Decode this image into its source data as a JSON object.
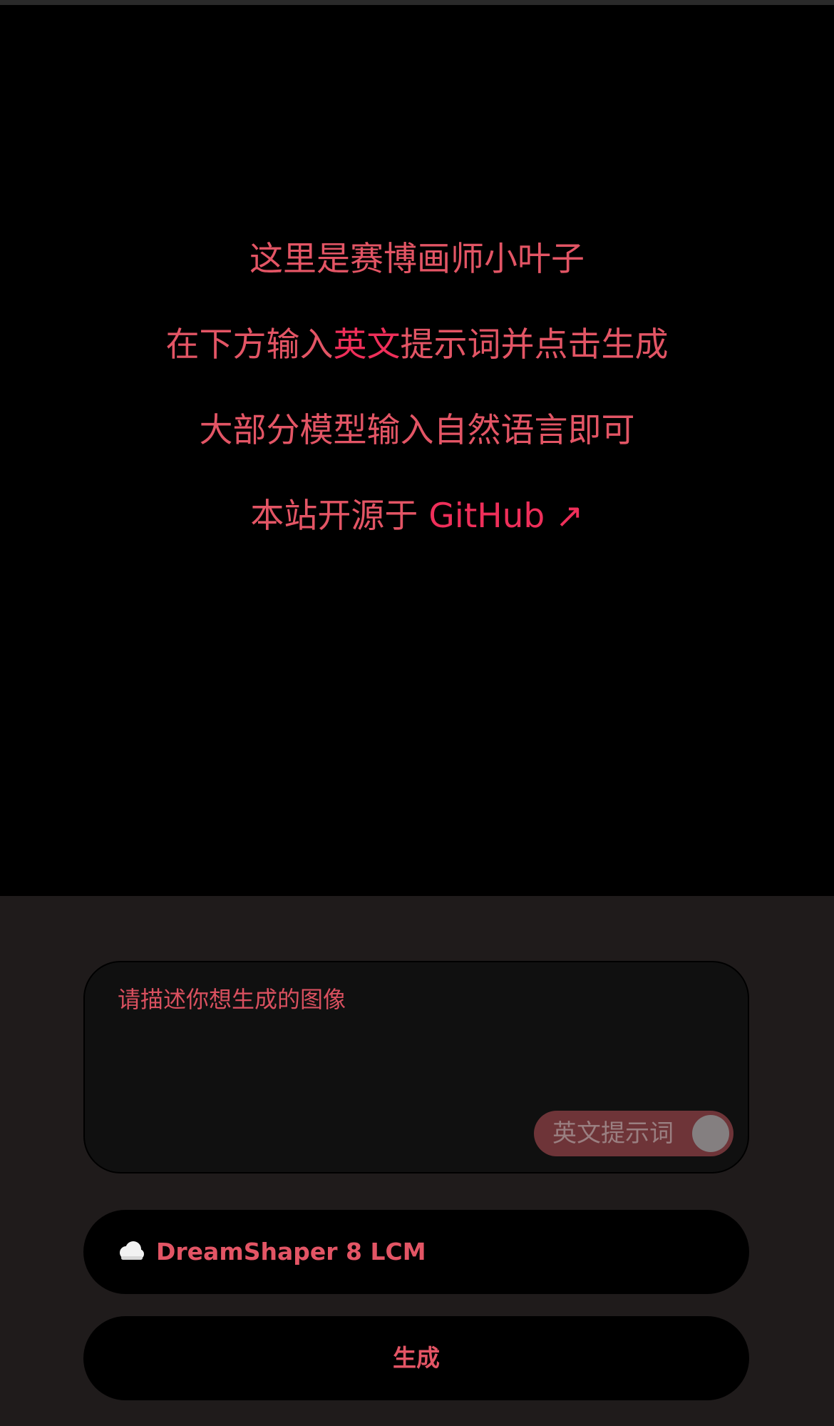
{
  "hero": {
    "line1": "这里是赛博画师小叶子",
    "line2_before": "在下方输入",
    "line2_highlight": "英文",
    "line2_after": "提示词并点击生成",
    "line3": "大部分模型输入自然语言即可",
    "line4_text": "本站开源于 ",
    "line4_link": "GitHub ↗"
  },
  "prompt": {
    "placeholder": "请描述你想生成的图像",
    "value": ""
  },
  "toggle": {
    "label": "英文提示词",
    "enabled": false
  },
  "model": {
    "icon": "cloud-icon",
    "label": "DreamShaper 8 LCM"
  },
  "actions": {
    "generate_label": "生成"
  },
  "colors": {
    "accent": "#e35565",
    "highlight": "#ef2f5a",
    "panel_bg": "#1f1b1b",
    "toggle_bg": "#6e3438"
  }
}
